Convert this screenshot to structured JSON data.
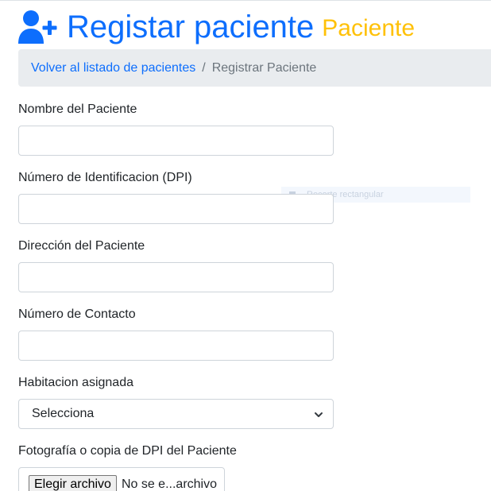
{
  "header": {
    "title": "Registar paciente",
    "subtitle": "Paciente",
    "icon": "user-plus-icon",
    "title_color": "#0d6efd",
    "subtitle_color": "#ffc107"
  },
  "breadcrumb": {
    "link": "Volver al listado de pacientes",
    "separator": "/",
    "active": "Registrar Paciente"
  },
  "form": {
    "nombre_label": "Nombre del Paciente",
    "nombre_value": "",
    "dpi_label": "Número de Identificacion (DPI)",
    "dpi_value": "",
    "direccion_label": "Dirección del Paciente",
    "direccion_value": "",
    "contacto_label": "Número de Contacto",
    "contacto_value": "",
    "habitacion_label": "Habitacion asignada",
    "habitacion_selected": "Selecciona",
    "foto_label": "Fotografía o copia de DPI del Paciente",
    "file_button": "Elegir archivo",
    "file_status": "No se e...archivo"
  },
  "overlay": {
    "ghost_text": "Recorte rectangular"
  }
}
